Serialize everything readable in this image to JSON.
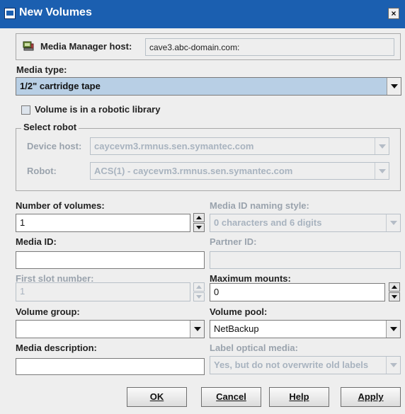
{
  "window": {
    "title": "New Volumes",
    "close": "×"
  },
  "host": {
    "label": "Media Manager host:",
    "value": "cave3.abc-domain.com:"
  },
  "media_type": {
    "label": "Media type:",
    "value": "1/2\" cartridge tape"
  },
  "robotic": {
    "label": "Volume is in a robotic library",
    "checked": false
  },
  "robot_group": {
    "legend": "Select robot",
    "device_host_label": "Device host:",
    "device_host_value": "caycevm3.rmnus.sen.symantec.com",
    "robot_label": "Robot:",
    "robot_value": "ACS(1) - caycevm3.rmnus.sen.symantec.com"
  },
  "num_volumes": {
    "label": "Number of volumes:",
    "value": "1"
  },
  "naming_style": {
    "label": "Media ID naming style:",
    "value": "0 characters and 6 digits"
  },
  "media_id": {
    "label": "Media ID:",
    "value": ""
  },
  "partner_id": {
    "label": "Partner ID:",
    "value": ""
  },
  "first_slot": {
    "label": "First slot number:",
    "value": "1"
  },
  "max_mounts": {
    "label": "Maximum mounts:",
    "value": "0"
  },
  "volume_group": {
    "label": "Volume group:",
    "value": ""
  },
  "volume_pool": {
    "label": "Volume pool:",
    "value": "NetBackup"
  },
  "media_desc": {
    "label": "Media description:",
    "value": ""
  },
  "label_optical": {
    "label": "Label optical media:",
    "value": "Yes, but do not overwrite old labels"
  },
  "buttons": {
    "ok": "OK",
    "cancel": "Cancel",
    "help": "Help",
    "apply": "Apply"
  },
  "colors": {
    "titlebar": "#1b5fb0",
    "selected_combo": "#b8cfe5",
    "disabled_text": "#a8b3bf"
  },
  "icons": {
    "window": "window-icon",
    "host": "host-computer-icon"
  }
}
